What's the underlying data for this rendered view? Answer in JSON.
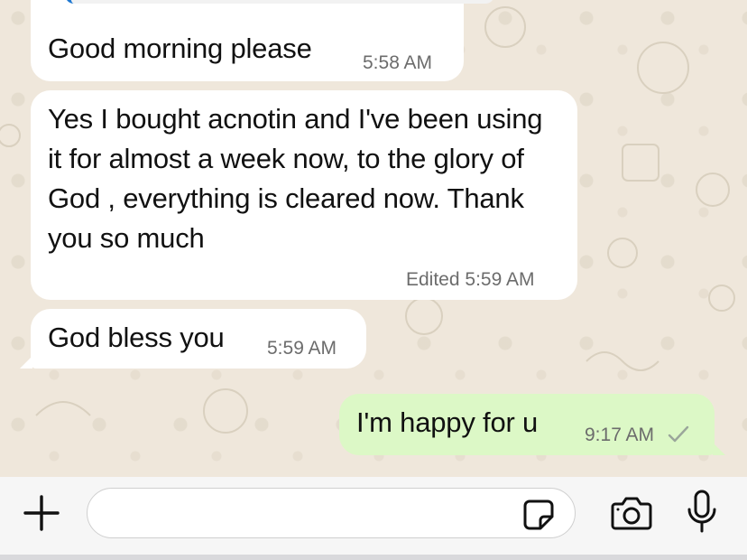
{
  "messages": [
    {
      "text": "Good morning please",
      "time": "5:58 AM",
      "direction": "incoming"
    },
    {
      "text": "Yes I bought acnotin and I've been using it for almost a week now, to the glory of God , everything is cleared now. Thank you so much",
      "time": "5:59 AM",
      "edited_label": "Edited",
      "direction": "incoming"
    },
    {
      "text": "God bless you",
      "time": "5:59 AM",
      "direction": "incoming"
    },
    {
      "text": "I'm happy for u",
      "time": "9:17 AM",
      "direction": "outgoing",
      "status": "sent-check-icon"
    }
  ],
  "composer": {
    "input_value": "",
    "icons": [
      "plus-icon",
      "sticker-icon",
      "camera-icon",
      "microphone-icon"
    ]
  },
  "colors": {
    "incoming_bubble": "#ffffff",
    "outgoing_bubble": "#dcf8c6",
    "chat_background": "#efe7db",
    "quote_accent": "#1f78d1"
  }
}
